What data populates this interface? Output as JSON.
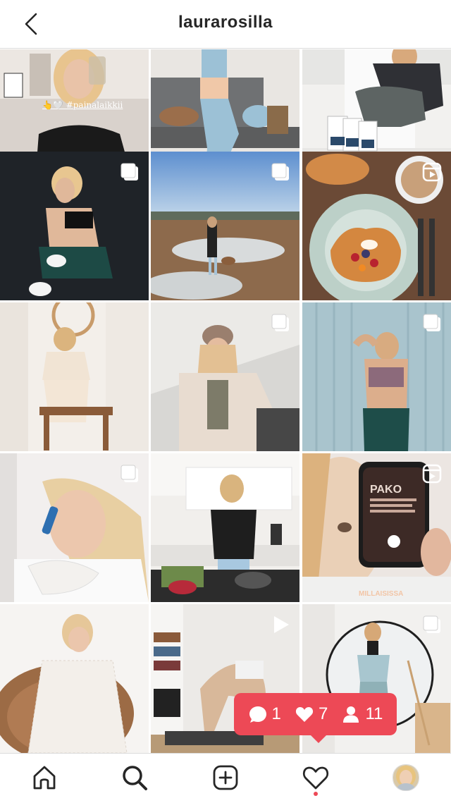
{
  "header": {
    "username": "laurarosilla",
    "back_icon": "chevron-left-icon"
  },
  "posts": [
    {
      "type": "photo",
      "tag": "👆🤍 #painalaikkii"
    },
    {
      "type": "photo"
    },
    {
      "type": "photo"
    },
    {
      "type": "carousel",
      "icon": "carousel-icon"
    },
    {
      "type": "carousel",
      "icon": "carousel-icon"
    },
    {
      "type": "reel",
      "icon": "reels-icon"
    },
    {
      "type": "photo"
    },
    {
      "type": "carousel",
      "icon": "carousel-icon"
    },
    {
      "type": "carousel",
      "icon": "carousel-icon"
    },
    {
      "type": "carousel",
      "icon": "carousel-icon"
    },
    {
      "type": "photo"
    },
    {
      "type": "reel",
      "icon": "reels-icon",
      "caption": "MILLAISISSA"
    },
    {
      "type": "photo"
    },
    {
      "type": "video",
      "icon": "play-icon"
    },
    {
      "type": "carousel",
      "icon": "carousel-icon"
    }
  ],
  "activity": {
    "comments": "1",
    "likes": "7",
    "followers": "11"
  },
  "nav": {
    "items": [
      "home-icon",
      "search-icon",
      "new-post-icon",
      "activity-icon",
      "profile-avatar"
    ]
  },
  "colors": {
    "accent": "#ed4956",
    "text": "#262626",
    "divider": "#dbdbdb"
  }
}
